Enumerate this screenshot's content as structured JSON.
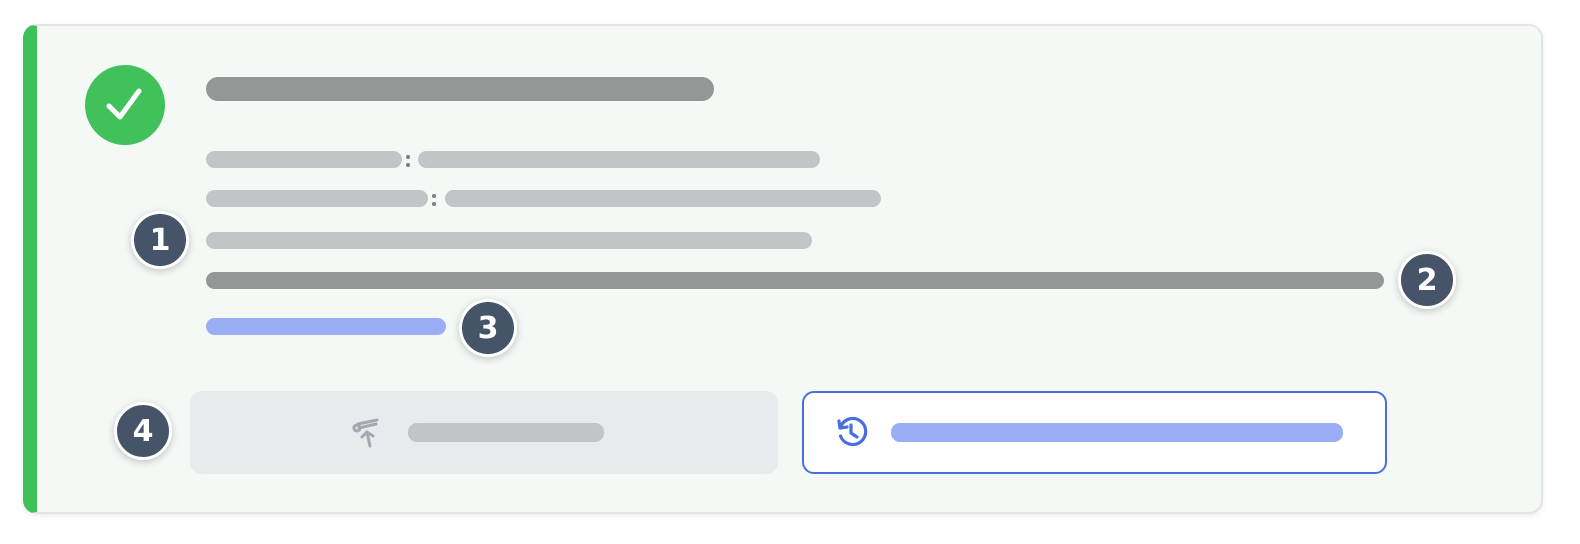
{
  "status": {
    "state": "success",
    "icon": "check-icon",
    "accent_color": "#3fc159"
  },
  "annotations": {
    "markers": [
      "1",
      "2",
      "3",
      "4"
    ]
  },
  "actions": {
    "primary_icon": "telescope-icon",
    "secondary_icon": "history-icon",
    "secondary_accent": "#4a6ee0"
  }
}
